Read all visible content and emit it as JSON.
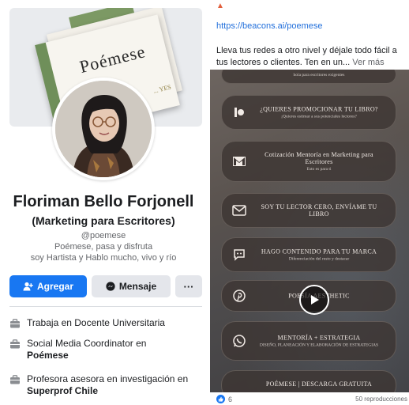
{
  "profile": {
    "cover_book_title": "Poémese",
    "cover_book_footer": "... YES",
    "name": "Floriman Bello Forjonell",
    "subtitle": "(Marketing para Escritores)",
    "handle": "@poemese",
    "bio_line1": "Poémese, pasa y disfruta",
    "bio_line2": "soy Hartista y Hablo mucho, vivo y río",
    "buttons": {
      "add": "Agregar",
      "message": "Mensaje",
      "more": "···"
    },
    "info": [
      {
        "icon": "briefcase-icon",
        "prefix": "Trabaja en Docente Universitaria",
        "bold": ""
      },
      {
        "icon": "briefcase-icon",
        "prefix": "Social Media Coordinator en",
        "bold": "Poémese"
      },
      {
        "icon": "briefcase-icon",
        "prefix": "Profesora asesora en investigación en",
        "bold": "Superprof Chile"
      }
    ]
  },
  "post": {
    "link": "https://beacons.ai/poemese",
    "text": "Lleva tus redes a otro nivel y déjale todo fácil a tus lectores o  clientes. Ten en un...",
    "see_more": "Ver más",
    "video_items": [
      {
        "icon": "none",
        "title": "",
        "sub": "hola para escritores exigentes"
      },
      {
        "icon": "bar-icon",
        "title": "¿QUIERES PROMOCIONAR TU LIBRO?",
        "sub": "¡Quieres estimar a sus potenciales lectores?"
      },
      {
        "icon": "gmail-icon",
        "title": "Cotización Mentoría en Marketing para Escritores",
        "sub": "Esto es para ti"
      },
      {
        "icon": "mail-icon",
        "title": "SOY TU LECTOR CERO, ENVÍAME TU LIBRO",
        "sub": ""
      },
      {
        "icon": "chat-icon",
        "title": "HAGO CONTENIDO PARA TU MARCA",
        "sub": "Diferenciación del resto y destacar"
      },
      {
        "icon": "pinterest-icon",
        "title": "POESÍA AESTHETIC",
        "sub": ""
      },
      {
        "icon": "whatsapp-icon",
        "title": "MENTORÍA + ESTRATEGIA",
        "sub": "DISEÑO, PLANEACIÓN Y ELABORACIÓN DE ESTRATEGIAS"
      },
      {
        "icon": "none",
        "title": "POÉMESE | DESCARGA GRATUITA",
        "sub": ""
      }
    ],
    "reactions_count": "6",
    "views": "50 reproducciones",
    "colors": {
      "link": "#216fdb",
      "accent": "#1877f2"
    }
  }
}
